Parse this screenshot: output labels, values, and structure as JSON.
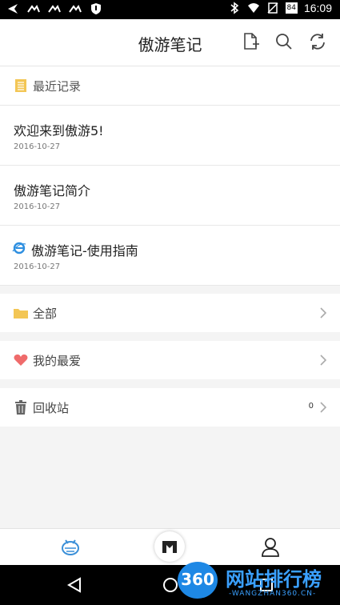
{
  "status_bar": {
    "time": "16:09",
    "battery": "84",
    "icons": [
      "navigation-icon",
      "signal-ca-icon",
      "signal-ca-icon",
      "signal-ca-icon",
      "shield-icon",
      "bluetooth-icon",
      "wifi-icon",
      "no-sim-icon",
      "battery-icon"
    ]
  },
  "app_bar": {
    "title": "傲游笔记",
    "icons": [
      "new-note-icon",
      "search-icon",
      "sync-icon"
    ]
  },
  "recent": {
    "header": "最近记录",
    "items": [
      {
        "title": "欢迎来到傲游5!",
        "date": "2016-10-27"
      },
      {
        "title": "傲游笔记简介",
        "date": "2016-10-27"
      },
      {
        "title": "傲游笔记-使用指南",
        "date": "2016-10-27"
      }
    ]
  },
  "folders": {
    "all": "全部",
    "favorites": "我的最爱",
    "trash": "回收站",
    "trash_count": "0"
  },
  "colors": {
    "folder": "#f3c655",
    "heart": "#ef6b6b",
    "ie_blue": "#2e8fe0",
    "nav_active": "#3a8fd8"
  },
  "watermark": {
    "badge": "360",
    "title": "网站排行榜",
    "subtitle": "-WANGZHAN360.CN-"
  }
}
